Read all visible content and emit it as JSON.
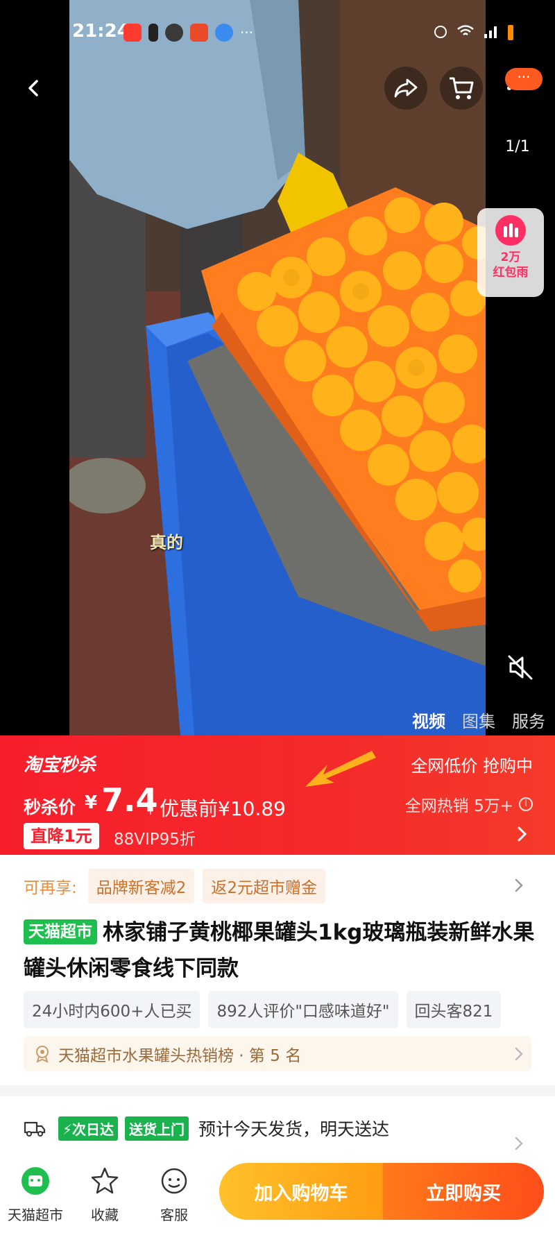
{
  "status_bar": {
    "time": "21:24",
    "more": "···"
  },
  "media": {
    "page_counter": "1/1",
    "red_packet": {
      "line1": "2万",
      "line2": "红包雨"
    },
    "caption": "真的",
    "tabs": [
      {
        "label": "视频",
        "active": true
      },
      {
        "label": "图集",
        "active": false
      },
      {
        "label": "服务",
        "active": false
      }
    ],
    "more_badge": "···"
  },
  "flash_sale": {
    "logo": "淘宝秒杀",
    "sale_label": "秒杀价",
    "currency": "¥",
    "price": "7.4",
    "original_price": "优惠前¥10.89",
    "drop_badge": "直降1元",
    "vip_text": "88VIP95折",
    "right_line1": "全网低价 抢购中",
    "right_line2": "全网热销 5万+",
    "info_icon": "i"
  },
  "promo": {
    "label": "可再享:",
    "chips": [
      "品牌新客减2",
      "返2元超市赠金"
    ]
  },
  "product": {
    "store_tag": "天猫超市",
    "title": "林家铺子黄桃椰果罐头1kg玻璃瓶装新鲜水果罐头休闲零食线下同款"
  },
  "stats": [
    "24小时内600+人已买",
    "892人评价\"口感味道好\"",
    "回头客821"
  ],
  "rank": {
    "text": "天猫超市水果罐头热销榜 · 第 5 名"
  },
  "delivery": {
    "tags": [
      "⚡次日达",
      "送货上门"
    ],
    "text": "预计今天发货，明天送达"
  },
  "bottom_bar": {
    "items": [
      {
        "label": "天猫超市"
      },
      {
        "label": "收藏"
      },
      {
        "label": "客服"
      }
    ],
    "add_to_cart": "加入购物车",
    "buy_now": "立即购买"
  },
  "colors": {
    "flash_red": "#f81e2c",
    "tmall_green": "#1fbf4f",
    "cart_yellow": "#ffb21e",
    "buy_orange": "#ff5a1a"
  }
}
